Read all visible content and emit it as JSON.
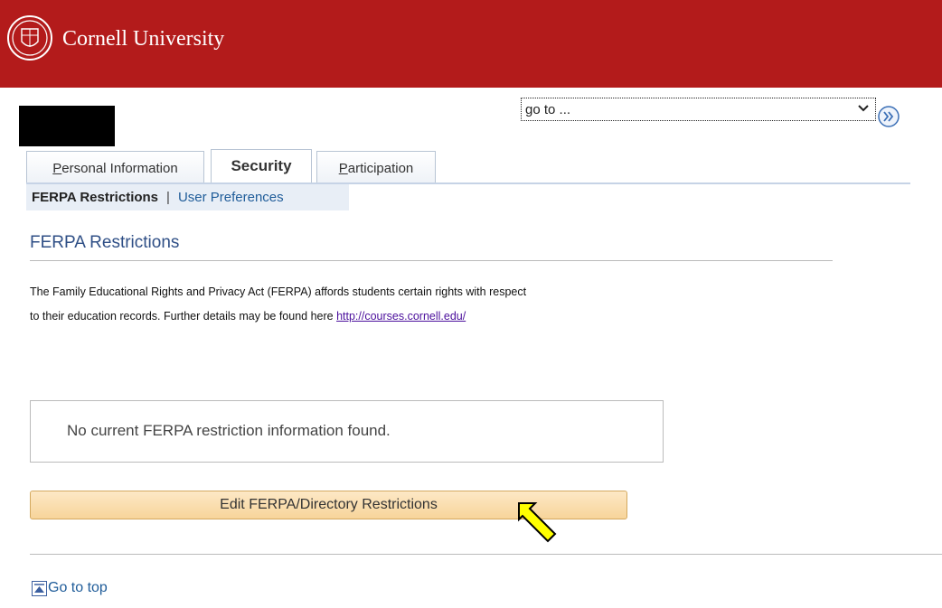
{
  "header": {
    "brand": "Cornell University",
    "accent": "#b31b1b"
  },
  "nav": {
    "goto_value": "go to ...",
    "tabs": [
      {
        "label_accel": "P",
        "label_rest": "ersonal Information",
        "active": false
      },
      {
        "label": "Security",
        "active": true
      },
      {
        "label_accel": "P",
        "label_rest": "articipation",
        "active": false
      }
    ],
    "subnav": {
      "current": "FERPA Restrictions",
      "separator": "|",
      "link": "User Preferences"
    }
  },
  "main": {
    "title": "FERPA Restrictions",
    "desc_line1": "The Family Educational Rights and Privacy Act (FERPA) affords students certain rights with respect",
    "desc_line2": "to their education records. Further details may be found here ",
    "desc_link": "http://courses.cornell.edu/",
    "message": "No current FERPA restriction information found.",
    "button_label": "Edit FERPA/Directory Restrictions"
  },
  "footer": {
    "go_to_top": "Go to top"
  },
  "icons": {
    "seal": "cornell-seal-icon",
    "go": "double-chevron-icon",
    "dropdown": "chevron-down-icon",
    "cursor": "arrow-cursor-icon",
    "top": "go-to-top-icon"
  }
}
